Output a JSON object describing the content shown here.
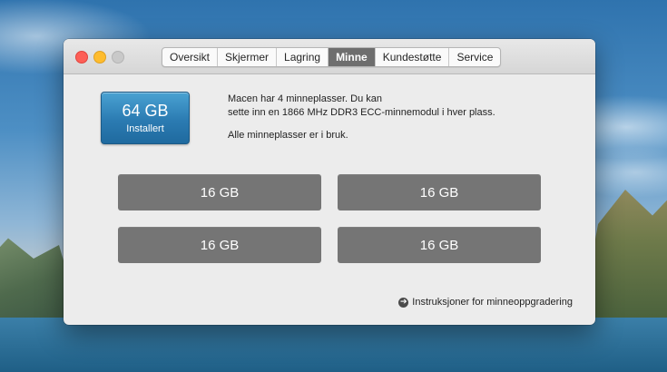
{
  "window": {
    "tabs": [
      {
        "label": "Oversikt",
        "active": false
      },
      {
        "label": "Skjermer",
        "active": false
      },
      {
        "label": "Lagring",
        "active": false
      },
      {
        "label": "Minne",
        "active": true
      },
      {
        "label": "Kundestøtte",
        "active": false
      },
      {
        "label": "Service",
        "active": false
      }
    ]
  },
  "memory": {
    "total": "64 GB",
    "installed_label": "Installert",
    "description_line1": "Macen har 4 minneplasser. Du kan",
    "description_line2": "sette inn en 1866 MHz DDR3 ECC-minnemodul i hver plass.",
    "status": "Alle minneplasser er i bruk.",
    "slots": [
      "16 GB",
      "16 GB",
      "16 GB",
      "16 GB"
    ]
  },
  "upgrade_link": {
    "icon": "arrow-circle-icon",
    "label": "Instruksjoner for minneoppgradering"
  },
  "colors": {
    "badge": "#2b7bb2",
    "slot": "#757575",
    "active_tab": "#6e6e6e",
    "close": "#fd5f57",
    "minimize": "#febc2e",
    "zoom_disabled": "#c9c9c9"
  }
}
